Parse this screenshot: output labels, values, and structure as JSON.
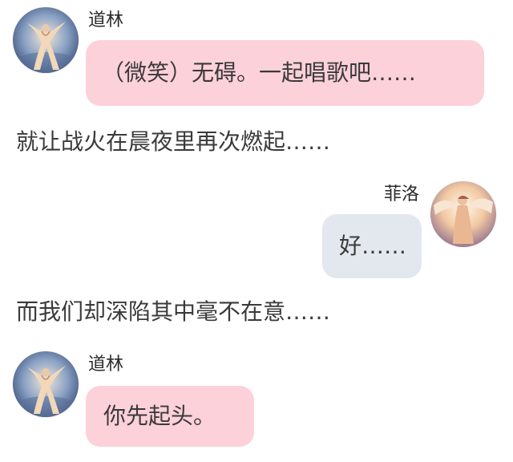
{
  "colors": {
    "left_bubble": "#fdd1da",
    "right_bubble": "#e3e8ef",
    "text": "#3a3a3a",
    "background": "#ffffff"
  },
  "messages": [
    {
      "type": "chat",
      "side": "left",
      "speaker": "道林",
      "text": "（微笑）无碍。一起唱歌吧……",
      "avatar_icon": "daolin-avatar-icon"
    },
    {
      "type": "narration",
      "text": "就让战火在晨夜里再次燃起……"
    },
    {
      "type": "chat",
      "side": "right",
      "speaker": "菲洛",
      "text": "好……",
      "avatar_icon": "feiluo-avatar-icon"
    },
    {
      "type": "narration",
      "text": "而我们却深陷其中毫不在意……"
    },
    {
      "type": "chat",
      "side": "left",
      "speaker": "道林",
      "text": "你先起头。",
      "avatar_icon": "daolin-avatar-icon"
    }
  ]
}
